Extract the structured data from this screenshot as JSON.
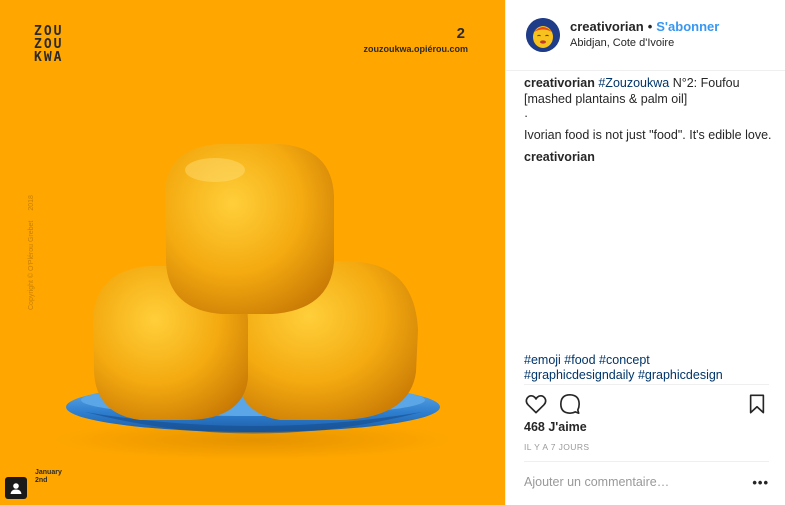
{
  "image": {
    "logo_lines": [
      "ZOU",
      "ZOU",
      "KWA"
    ],
    "number": "2",
    "site": "zouzoukwa.opiérou.com",
    "copyright": "Copyright © O'Plérou Grebet",
    "year": "2018",
    "date_month": "January",
    "date_day": "2nd",
    "background_color": "#ffa700",
    "corner_icon": "user-tag-icon"
  },
  "header": {
    "username": "creativorian",
    "separator": "•",
    "follow_label": "S'abonner",
    "location": "Abidjan, Cote d'Ivoire",
    "avatar_icon": "emoji-face-avatar"
  },
  "caption": {
    "author": "creativorian",
    "hashtag": "#Zouzoukwa",
    "text_after_tag": " N°2: Foufou [mashed plantains & palm oil]",
    "dot_line": "·",
    "body": "Ivorian food is not just \"food\". It's edible love.",
    "reply_author": "creativorian"
  },
  "tags": {
    "line1": "#emoji #food #concept",
    "line2": "#graphicdesigndaily #graphicdesign"
  },
  "actions": {
    "like_icon": "heart-icon",
    "comment_icon": "comment-icon",
    "save_icon": "bookmark-icon"
  },
  "likes": "468 J'aime",
  "time_ago": "IL Y A 7 JOURS",
  "add_comment": {
    "placeholder": "Ajouter un commentaire…",
    "more_label": "•••"
  },
  "colors": {
    "link_blue": "#3897f0",
    "hashtag_blue": "#003569",
    "muted_gray": "#999999"
  }
}
